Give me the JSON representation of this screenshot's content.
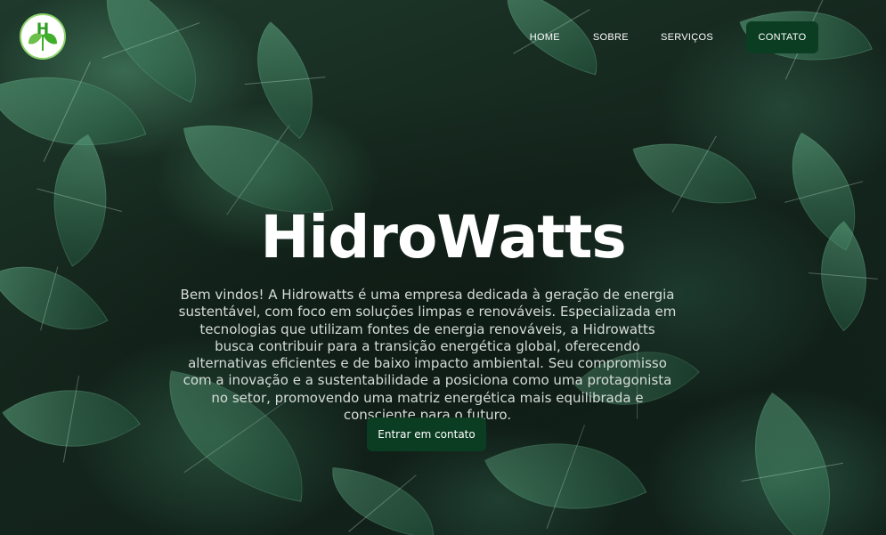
{
  "header": {
    "logo": {
      "icon": "leaf-h-logo-icon",
      "letter": "H"
    },
    "nav": {
      "home": "HOME",
      "sobre": "SOBRE",
      "servicos": "SERVIÇOS",
      "contato": "CONTATO"
    }
  },
  "hero": {
    "title": "HidroWatts",
    "description": "Bem vindos! A Hidrowatts é uma empresa dedicada à geração de energia sustentável, com foco em soluções limpas e renováveis. Especializada em tecnologias que utilizam fontes de energia renováveis, a Hidrowatts busca contribuir para a transição energética global, oferecendo alternativas eficientes e de baixo impacto ambiental. Seu compromisso com a inovação e a sustentabilidade a posiciona como uma protagonista no setor, promovendo uma matriz energética mais equilibrada e consciente para o futuro.",
    "cta": "Entrar em contato",
    "background": "leaves-background"
  },
  "colors": {
    "button_bg": "#0b3d22",
    "logo_green": "#3fae2a",
    "text_light": "#d6dcd8"
  }
}
